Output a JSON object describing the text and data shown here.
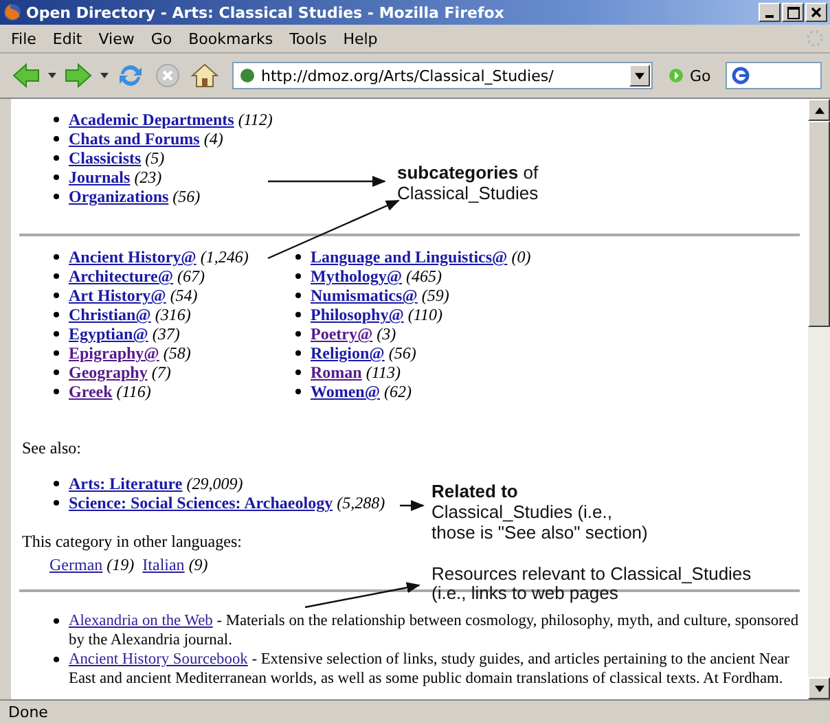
{
  "window": {
    "title": "Open Directory - Arts: Classical Studies - Mozilla Firefox"
  },
  "menu": [
    {
      "label": "File"
    },
    {
      "label": "Edit"
    },
    {
      "label": "View"
    },
    {
      "label": "Go"
    },
    {
      "label": "Bookmarks"
    },
    {
      "label": "Tools"
    },
    {
      "label": "Help"
    }
  ],
  "toolbar": {
    "url": "http://dmoz.org/Arts/Classical_Studies/",
    "go": "Go"
  },
  "subcategories": [
    {
      "name": "Academic Departments",
      "count": "(112)",
      "visited": false
    },
    {
      "name": "Chats and Forums",
      "count": "(4)",
      "visited": false
    },
    {
      "name": "Classicists",
      "count": "(5)",
      "visited": false
    },
    {
      "name": "Journals",
      "count": "(23)",
      "visited": false
    },
    {
      "name": "Organizations",
      "count": "(56)",
      "visited": false
    }
  ],
  "related_columns": [
    [
      {
        "name": "Ancient History@",
        "count": "(1,246)",
        "visited": false
      },
      {
        "name": "Architecture@",
        "count": "(67)",
        "visited": false
      },
      {
        "name": "Art History@",
        "count": "(54)",
        "visited": false
      },
      {
        "name": "Christian@",
        "count": "(316)",
        "visited": false
      },
      {
        "name": "Egyptian@",
        "count": "(37)",
        "visited": false
      },
      {
        "name": "Epigraphy@",
        "count": "(58)",
        "visited": true
      },
      {
        "name": "Geography",
        "count": "(7)",
        "visited": true
      },
      {
        "name": "Greek",
        "count": "(116)",
        "visited": true
      }
    ],
    [
      {
        "name": "Language and Linguistics@",
        "count": "(0)",
        "visited": false
      },
      {
        "name": "Mythology@",
        "count": "(465)",
        "visited": false
      },
      {
        "name": "Numismatics@",
        "count": "(59)",
        "visited": false
      },
      {
        "name": "Philosophy@",
        "count": "(110)",
        "visited": false
      },
      {
        "name": "Poetry@",
        "count": "(3)",
        "visited": true
      },
      {
        "name": "Religion@",
        "count": "(56)",
        "visited": false
      },
      {
        "name": "Roman",
        "count": "(113)",
        "visited": true
      },
      {
        "name": "Women@",
        "count": "(62)",
        "visited": false
      }
    ]
  ],
  "see_also": {
    "label": "See also:",
    "items": [
      {
        "name": "Arts: Literature",
        "count": "(29,009)",
        "visited": false
      },
      {
        "name": "Science: Social Sciences: Archaeology",
        "count": "(5,288)",
        "visited": false
      }
    ]
  },
  "languages": {
    "label": "This category in other languages:",
    "items": [
      {
        "name": "German",
        "count": "(19)"
      },
      {
        "name": "Italian",
        "count": "(9)"
      }
    ]
  },
  "sites": [
    {
      "name": "Alexandria on the Web",
      "description": "- Materials on the relationship between cosmology, philosophy, myth, and culture, sponsored by the Alexandria journal."
    },
    {
      "name": "Ancient History Sourcebook",
      "description": "- Extensive selection of links, study guides, and articles pertaining to the ancient Near East and ancient Mediterranean worlds, as well as some public domain translations of classical texts. At Fordham."
    }
  ],
  "annotations": [
    {
      "kind": "subcategories",
      "text": "**subcategories** of Classical_Studies"
    },
    {
      "kind": "related",
      "title": "Related to",
      "text": "Classical_Studies (i.e., those is \"See also\" section)"
    },
    {
      "kind": "resources",
      "text": "Resources relevant to Classical_Studies (i.e., links to web pages"
    }
  ],
  "status_bar": {
    "text": "Done"
  }
}
